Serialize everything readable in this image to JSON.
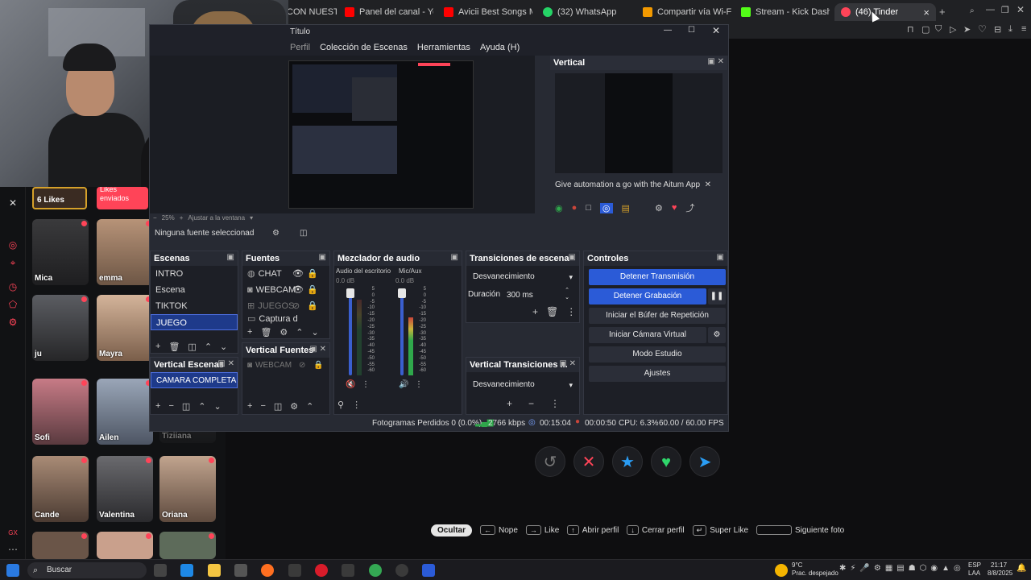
{
  "browser": {
    "tabs": [
      {
        "label": "CON NUESTR",
        "color": "#9aa0a6"
      },
      {
        "label": "Panel del canal - YouTub",
        "color": "#ff0000"
      },
      {
        "label": "Avicii Best Songs Mix -",
        "color": "#ff0000"
      },
      {
        "label": "(32) WhatsApp",
        "color": "#25d366"
      },
      {
        "label": "Compartir vía Wi-Fi",
        "color": "#f29900"
      },
      {
        "label": "Stream - Kick Dashboar",
        "color": "#53fc18"
      },
      {
        "label": "(46) Tinder",
        "color": "#ff4458"
      }
    ],
    "close_tab": "×",
    "new_tab": "+"
  },
  "obs": {
    "title": "Título",
    "menu": [
      "Perfil",
      "Colección de Escenas",
      "Herramientas",
      "Ayuda (H)"
    ],
    "preview_zoom": "25%",
    "preview_fit": "Ajustar a la ventana",
    "no_source": "Ninguna fuente seleccionad",
    "vertical_title": "Vertical",
    "vertical_banner": "Give automation a go with the Aitum App",
    "scenes_title": "Escenas",
    "scenes": [
      "INTRO",
      "Escena",
      "TIKTOK",
      "JUEGO"
    ],
    "sources_title": "Fuentes",
    "sources": [
      "CHAT",
      "WEBCAM",
      "JUEGOS",
      "Captura d"
    ],
    "mixer_title": "Mezclador de audio",
    "mixer_channels": [
      {
        "name": "Audio del escritorio",
        "db": "0.0 dB"
      },
      {
        "name": "Mic/Aux",
        "db": "0.0 dB"
      }
    ],
    "mixer_scale": [
      "5",
      "0",
      "-5",
      "-10",
      "-15",
      "-20",
      "-25",
      "-30",
      "-35",
      "-40",
      "-45",
      "-50",
      "-55",
      "-60"
    ],
    "transitions_title": "Transiciones de escena",
    "transition_value": "Desvanecimiento",
    "duration_label": "Duración",
    "duration_value": "300 ms",
    "controls_title": "Controles",
    "controls": [
      "Detener Transmisión",
      "Detener Grabación",
      "Iniciar el Búfer de Repetición",
      "Iniciar Cámara Virtual",
      "Modo Estudio",
      "Ajustes"
    ],
    "vertical_scenes_title": "Vertical Escenas",
    "vertical_scenes": [
      "CAMARA COMPLETA"
    ],
    "vertical_sources_title": "Vertical Fuentes",
    "vertical_sources": [
      "WEBCAM"
    ],
    "vertical_transitions_title": "Vertical Transiciones ...",
    "vertical_transition_value": "Desvanecimiento",
    "status": {
      "dropped": "Fotogramas Perdidos 0 (0.0%)",
      "bitrate": "2766 kbps",
      "stream_time": "00:15:04",
      "rec_time": "00:00:50",
      "cpu": "CPU: 6.3%",
      "fps": "60.00 / 60.00 FPS"
    }
  },
  "tinder": {
    "likes_count": "6 Likes",
    "likes_sent": "Likes enviados",
    "profiles": [
      "Mica",
      "emma",
      "ju",
      "Mayra",
      "Sofi",
      "Ailen",
      "Tiziiana",
      "Cande",
      "Valentina",
      "Oriana"
    ],
    "hints": {
      "hide": "Ocultar",
      "nope": "Nope",
      "like": "Like",
      "open_profile": "Abrir perfil",
      "close_profile": "Cerrar perfil",
      "super_like": "Super Like",
      "next_photo": "Siguiente foto"
    }
  },
  "taskbar": {
    "search": "Buscar",
    "weather_temp": "9°C",
    "weather_desc": "Prac. despejado",
    "lang": "ESP",
    "lang2": "LAA",
    "time": "21:17",
    "date": "8/8/2025"
  },
  "colors": {
    "accent_blue": "#2b5bd7",
    "tinder_red": "#ff4458",
    "like_green": "#2fd66b",
    "super_blue": "#2a9df4"
  }
}
